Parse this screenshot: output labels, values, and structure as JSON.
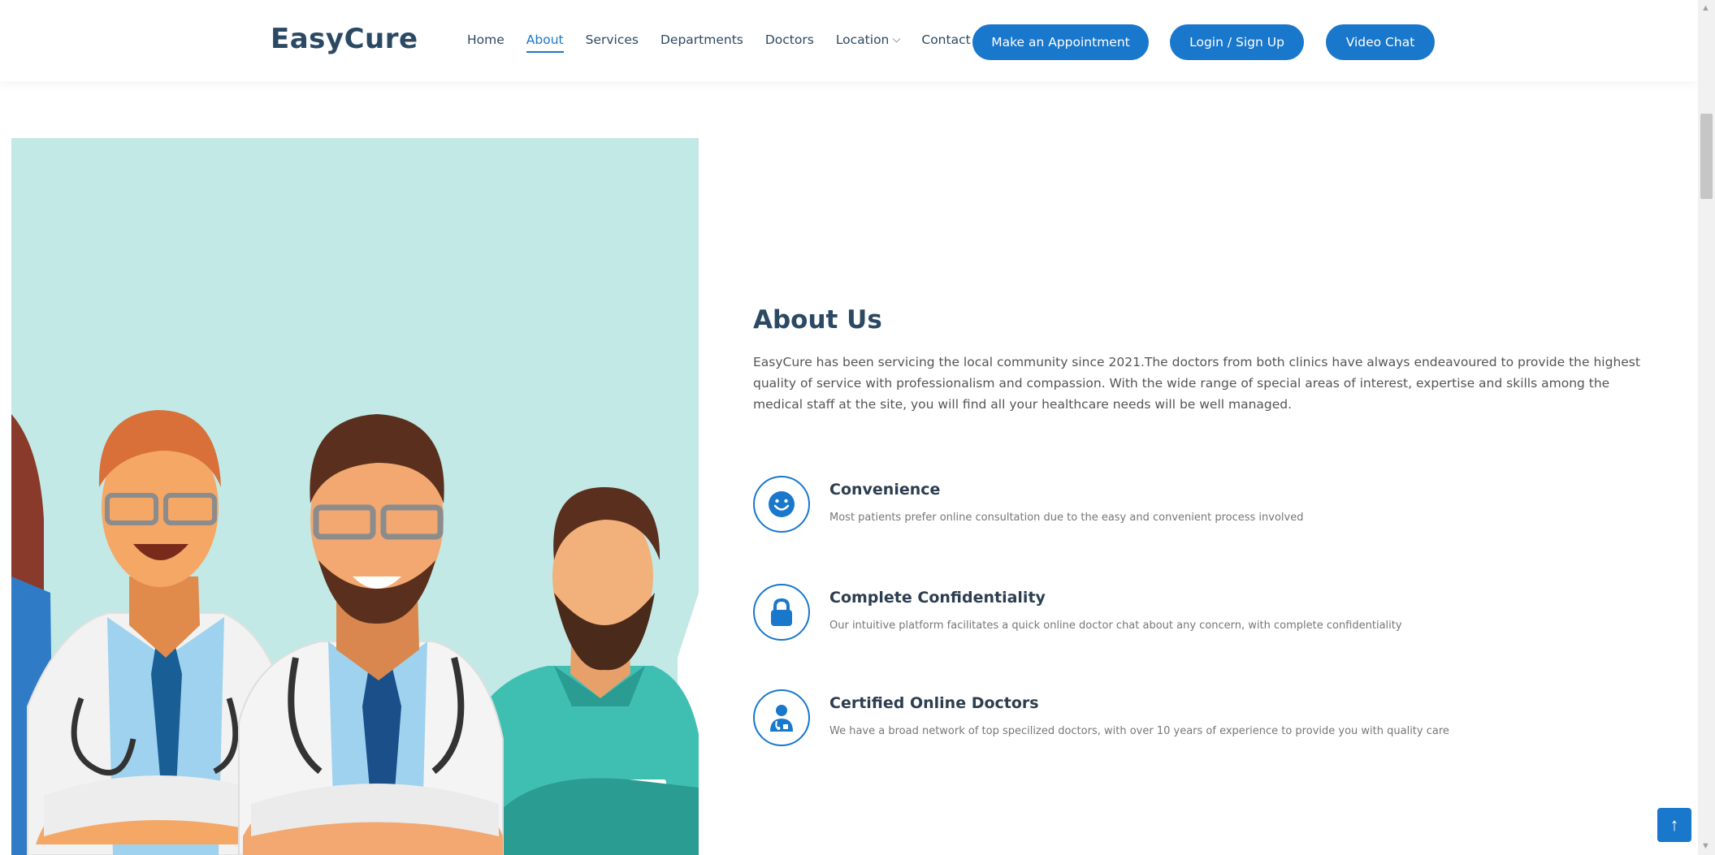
{
  "header": {
    "logo": "EasyCure",
    "nav": [
      {
        "label": "Home"
      },
      {
        "label": "About",
        "active": true
      },
      {
        "label": "Services"
      },
      {
        "label": "Departments"
      },
      {
        "label": "Doctors"
      },
      {
        "label": "Location",
        "dropdown": true
      },
      {
        "label": "Contact"
      }
    ],
    "buttons": {
      "appointment": "Make an Appointment",
      "login": "Login / Sign Up",
      "video": "Video Chat"
    }
  },
  "about": {
    "title": "About Us",
    "text": "EasyCure has been servicing the local community since 2021.The doctors from both clinics have always endeavoured to provide the highest quality of service with professionalism and compassion. With the wide range of special areas of interest, expertise and skills among the medical staff at the site, you will find all your healthcare needs will be well managed.",
    "features": [
      {
        "icon": "smile-icon",
        "title": "Convenience",
        "desc": "Most patients prefer online consultation due to the easy and convenient process involved"
      },
      {
        "icon": "lock-icon",
        "title": "Complete Confidentiality",
        "desc": "Our intuitive platform facilitates a quick online doctor chat about any concern, with complete confidentiality"
      },
      {
        "icon": "doctor-icon",
        "title": "Certified Online Doctors",
        "desc": "We have a broad network of top specilized doctors, with over 10 years of experience to provide you with quality care"
      }
    ]
  },
  "colors": {
    "primary": "#1977cc",
    "heading": "#2c4964",
    "illustration_bg": "#c2e9e6"
  },
  "back_to_top": {
    "icon": "arrow-up-icon",
    "glyph": "↑"
  }
}
